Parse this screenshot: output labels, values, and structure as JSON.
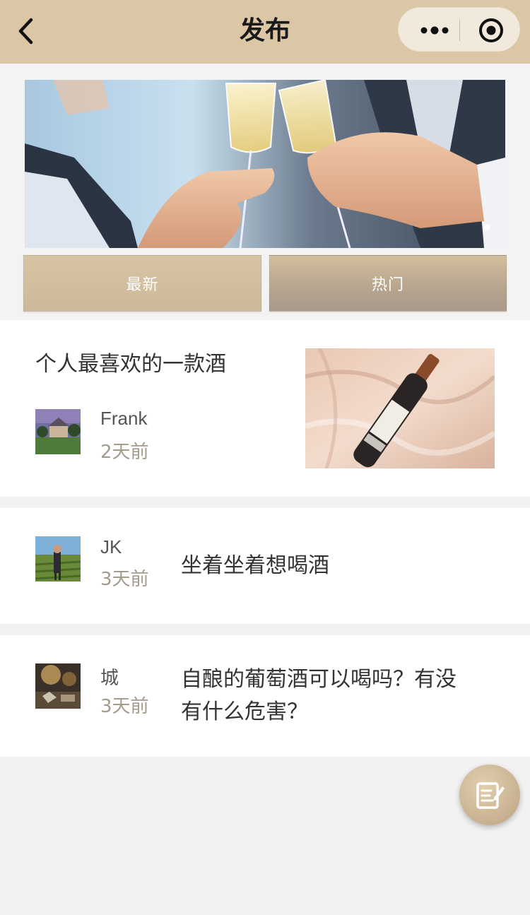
{
  "navbar": {
    "title": "发布",
    "back_icon": "chevron-left-icon",
    "more_icon": "more-dots-icon",
    "close_icon": "target-circle-icon",
    "background": "#dbc7a6"
  },
  "banner": {
    "image": "champagne-toast-photo",
    "indicator_count": 1,
    "active_indicator": 1
  },
  "tabs": [
    {
      "label": "最新"
    },
    {
      "label": "热门"
    }
  ],
  "posts": [
    {
      "title": "个人最喜欢的一款酒",
      "author": "Frank",
      "time": "2天前",
      "avatar": "castle-avatar",
      "image": "wine-bottle-on-silk-photo"
    },
    {
      "title": "坐着坐着想喝酒",
      "author": "JK",
      "time": "3天前",
      "avatar": "vineyard-man-avatar"
    },
    {
      "title_line1": "自酿的葡萄酒可以喝吗？有没",
      "title_line2": "有什么危害？",
      "author": "城",
      "time": "3天前",
      "avatar": "winery-avatar"
    }
  ],
  "fab": {
    "icon": "edit-note-icon"
  },
  "colors": {
    "accent": "#d4c09f",
    "time_text": "#a39b8b"
  }
}
